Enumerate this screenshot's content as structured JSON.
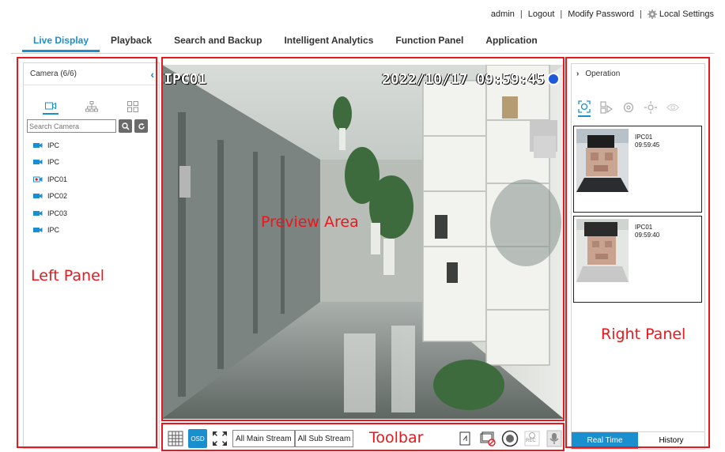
{
  "header": {
    "user": "admin",
    "logout": "Logout",
    "modify_password": "Modify Password",
    "local_settings": "Local Settings"
  },
  "nav": {
    "tabs": [
      {
        "label": "Live Display",
        "active": true
      },
      {
        "label": "Playback"
      },
      {
        "label": "Search and Backup"
      },
      {
        "label": "Intelligent Analytics"
      },
      {
        "label": "Function Panel"
      },
      {
        "label": "Application"
      }
    ]
  },
  "left_panel": {
    "title": "Camera (6/6)",
    "search_placeholder": "Search Camera",
    "cameras": [
      {
        "name": "IPC",
        "status": "online"
      },
      {
        "name": "IPC",
        "status": "online"
      },
      {
        "name": "IPC01",
        "status": "recording"
      },
      {
        "name": "IPC02",
        "status": "online"
      },
      {
        "name": "IPC03",
        "status": "online"
      },
      {
        "name": "IPC",
        "status": "online"
      }
    ]
  },
  "preview": {
    "osd_name": "IPC01",
    "osd_datetime": "2022/10/17 09:59:45"
  },
  "toolbar": {
    "osd_label": "OSD",
    "main_stream": "All Main Stream",
    "sub_stream": "All Sub Stream",
    "rec_label": "REC"
  },
  "right_panel": {
    "title": "Operation",
    "snapshots": [
      {
        "camera": "IPC01",
        "time": "09:59:45"
      },
      {
        "camera": "IPC01",
        "time": "09:59:40"
      }
    ],
    "tabs": {
      "real_time": "Real Time",
      "history": "History"
    }
  },
  "annotations": {
    "left": "Left Panel",
    "preview": "Preview Area",
    "right": "Right Panel",
    "toolbar": "Toolbar"
  },
  "colors": {
    "accent": "#1a8fd0",
    "annotation": "#e8181e"
  }
}
